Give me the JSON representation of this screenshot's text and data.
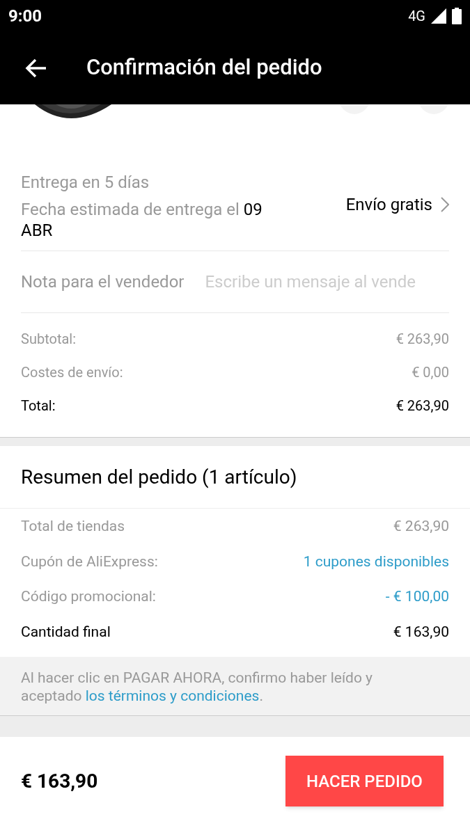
{
  "status_bar": {
    "time": "9:00",
    "network": "4G"
  },
  "toolbar": {
    "title": "Confirmación del pedido"
  },
  "delivery": {
    "days": "Entrega en 5 días",
    "estimate": "Fecha estimada de entrega el **09 ABR**",
    "shipping": "Envío gratis"
  },
  "note": {
    "label": "Nota para el vendedor",
    "placeholder": "Escribe un mensaje al vende"
  },
  "costs": [
    {
      "label": "Subtotal:",
      "value": "€ 263,90",
      "kind": "muted"
    },
    {
      "label": "Costes de envío:",
      "value": "€ 0,00",
      "kind": "muted"
    },
    {
      "label": "Total:",
      "value": "€ 263,90",
      "kind": "strong"
    }
  ],
  "summary": {
    "title": "Resumen del pedido (1 artículo)",
    "rows": [
      {
        "label": "Total de tiendas",
        "value": "€ 263,90",
        "kind": "muted"
      },
      {
        "label": "Cupón de AliExpress:",
        "value": "1 cupones disponibles",
        "kind": "link"
      },
      {
        "label": "Código promocional:",
        "value": "- € 100,00",
        "kind": "link"
      },
      {
        "label": "Cantidad final",
        "value": "€ 163,90",
        "kind": "strong"
      }
    ]
  },
  "terms": {
    "text": "Al hacer clic en PAGAR AHORA, confirmo haber leído y aceptado ",
    "link": "los términos y condiciones",
    "end": "."
  },
  "footer": {
    "price": "€ 163,90",
    "button": "HACER PEDIDO"
  }
}
